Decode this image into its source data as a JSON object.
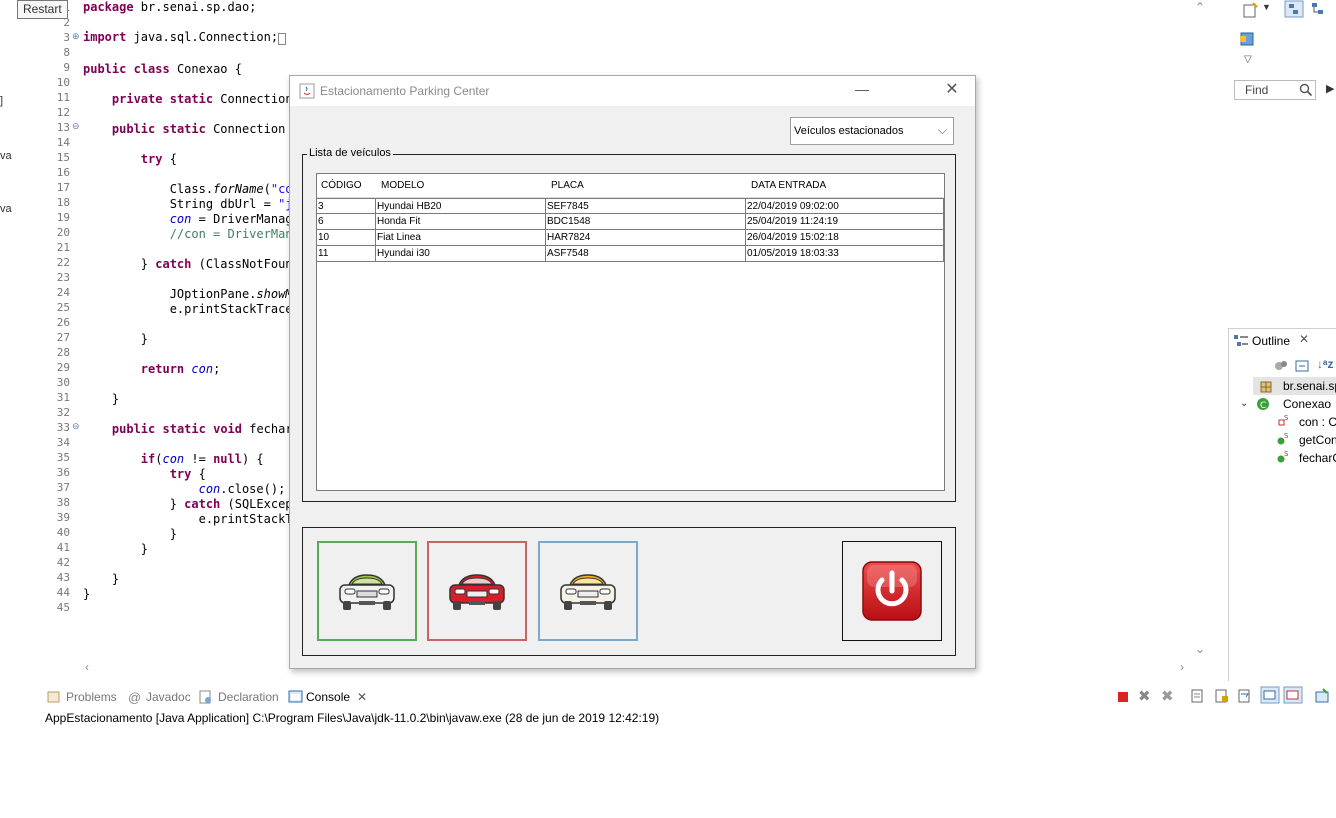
{
  "tooltip": {
    "restart": "Restart"
  },
  "editor": {
    "line_numbers": [
      "1",
      "2",
      "3",
      "8",
      "9",
      "10",
      "11",
      "12",
      "13",
      "14",
      "15",
      "16",
      "17",
      "18",
      "19",
      "20",
      "21",
      "22",
      "23",
      "24",
      "25",
      "26",
      "27",
      "28",
      "29",
      "30",
      "31",
      "32",
      "33",
      "34",
      "35",
      "36",
      "37",
      "38",
      "39",
      "40",
      "41",
      "42",
      "43",
      "44",
      "45"
    ],
    "left_stubs": [
      "]",
      "va",
      "va"
    ]
  },
  "swing_window": {
    "title": "Estacionamento Parking Center",
    "minimize": "—",
    "close": "✕",
    "filter": {
      "selected": "Veículos estacionados"
    },
    "list_title": "Lista de veículos",
    "table": {
      "columns": [
        "CÓDIGO",
        "MODELO",
        "PLACA",
        "DATA ENTRADA"
      ],
      "rows": [
        [
          "3",
          "Hyundai HB20",
          "SEF7845",
          "22/04/2019 09:02:00"
        ],
        [
          "6",
          "Honda Fit",
          "BDC1548",
          "25/04/2019 11:24:19"
        ],
        [
          "10",
          "Fiat Linea",
          "HAR7824",
          "26/04/2019 15:02:18"
        ],
        [
          "11",
          "Hyundai i30",
          "ASF7548",
          "01/05/2019 18:03:33"
        ]
      ]
    },
    "buttons": {
      "green_car": "car-green-icon",
      "red_car": "car-red-icon",
      "yellow_car": "car-yellow-icon",
      "power": "power-icon"
    },
    "colors": {
      "green": "#5aaa5a",
      "red": "#c86464",
      "yellow": "#f0b000",
      "power": "#d42020"
    }
  },
  "right_panel": {
    "find_placeholder": "Find",
    "outline_title": "Outline",
    "outline_items": [
      "br.senai.sp",
      "Conexao",
      "con : C",
      "getCon",
      "fecharC"
    ]
  },
  "console": {
    "tabs": [
      "Problems",
      "Javadoc",
      "Declaration",
      "Console"
    ],
    "launch_line": "AppEstacionamento [Java Application] C:\\Program Files\\Java\\jdk-11.0.2\\bin\\javaw.exe (28 de jun de 2019 12:42:19)"
  }
}
